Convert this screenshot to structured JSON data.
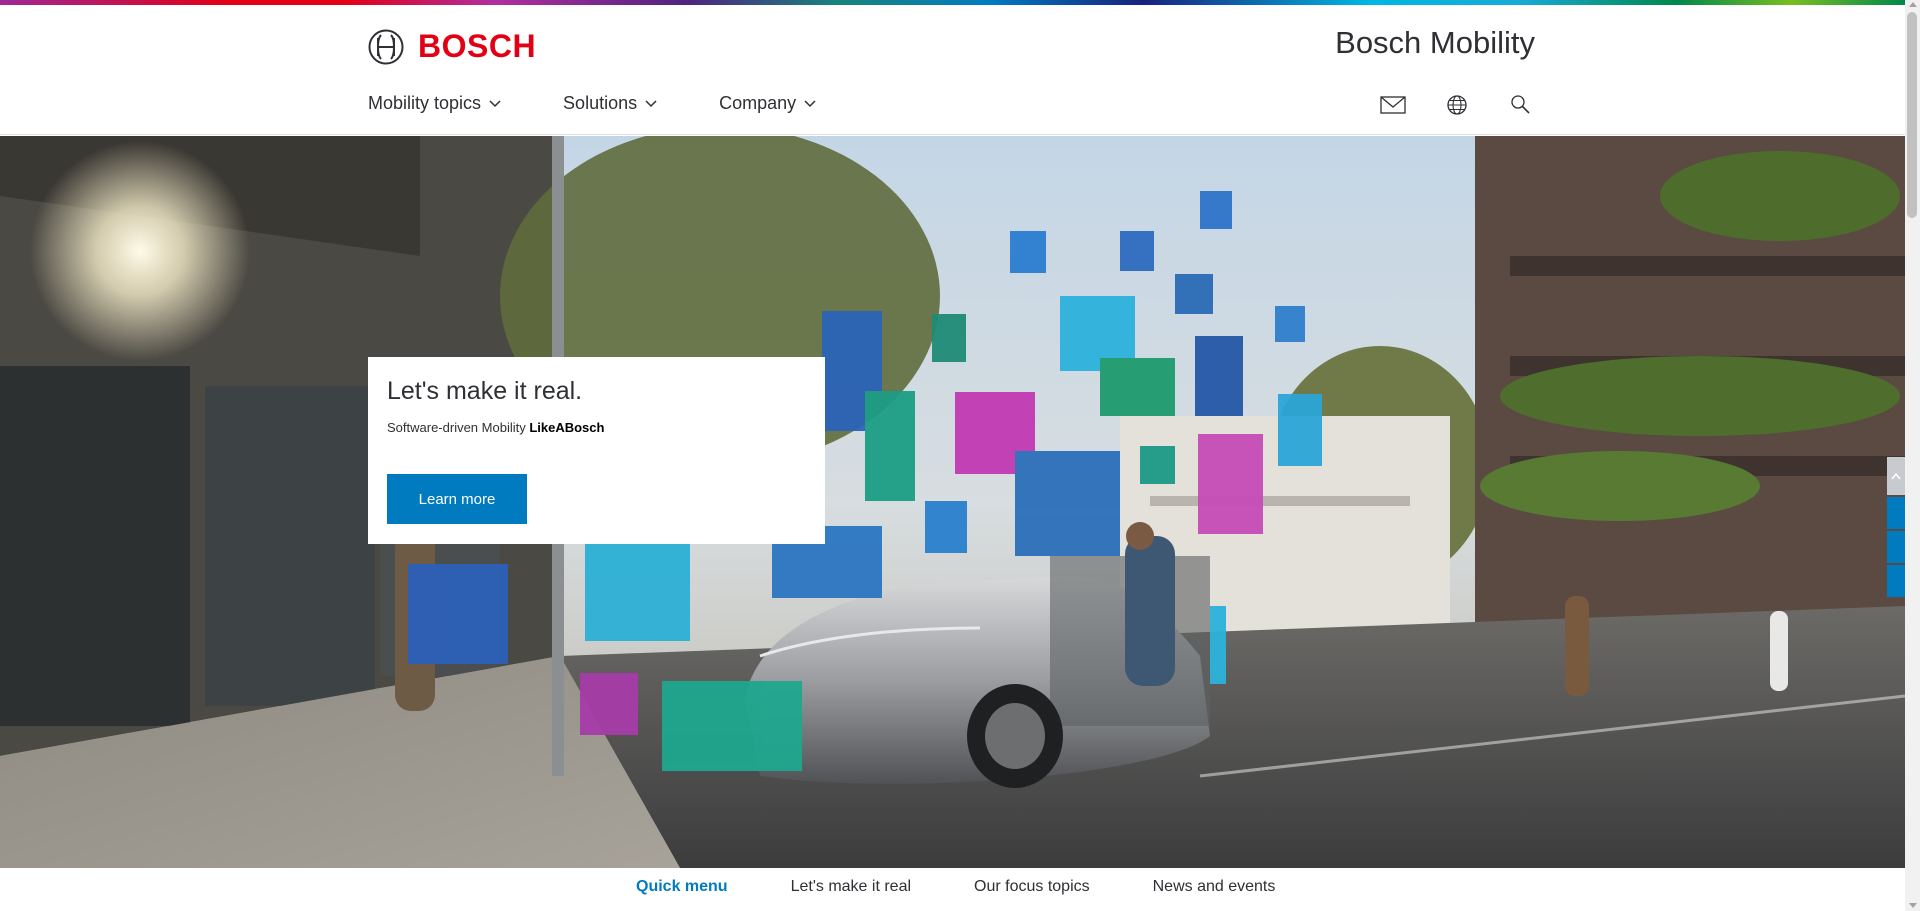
{
  "brand": {
    "logo_text": "BOSCH",
    "site_title": "Bosch Mobility",
    "brand_red": "#e20015"
  },
  "nav": {
    "items": [
      {
        "label": "Mobility topics"
      },
      {
        "label": "Solutions"
      },
      {
        "label": "Company"
      }
    ]
  },
  "utility": {
    "icons": [
      "mail-icon",
      "globe-icon",
      "search-icon"
    ]
  },
  "hero": {
    "title": "Let's make it real.",
    "subtitle_prefix": "Software-driven Mobility ",
    "subtitle_hashtag": "LikeABosch",
    "cta_label": "Learn more",
    "cta_color": "#007bc0"
  },
  "anchor_nav": {
    "items": [
      {
        "label": "Quick menu",
        "active": true
      },
      {
        "label": "Let's make it real",
        "active": false
      },
      {
        "label": "Our focus topics",
        "active": false
      },
      {
        "label": "News and events",
        "active": false
      }
    ]
  },
  "colors": {
    "text_primary": "#2e3033",
    "accent_blue": "#007bc0"
  }
}
